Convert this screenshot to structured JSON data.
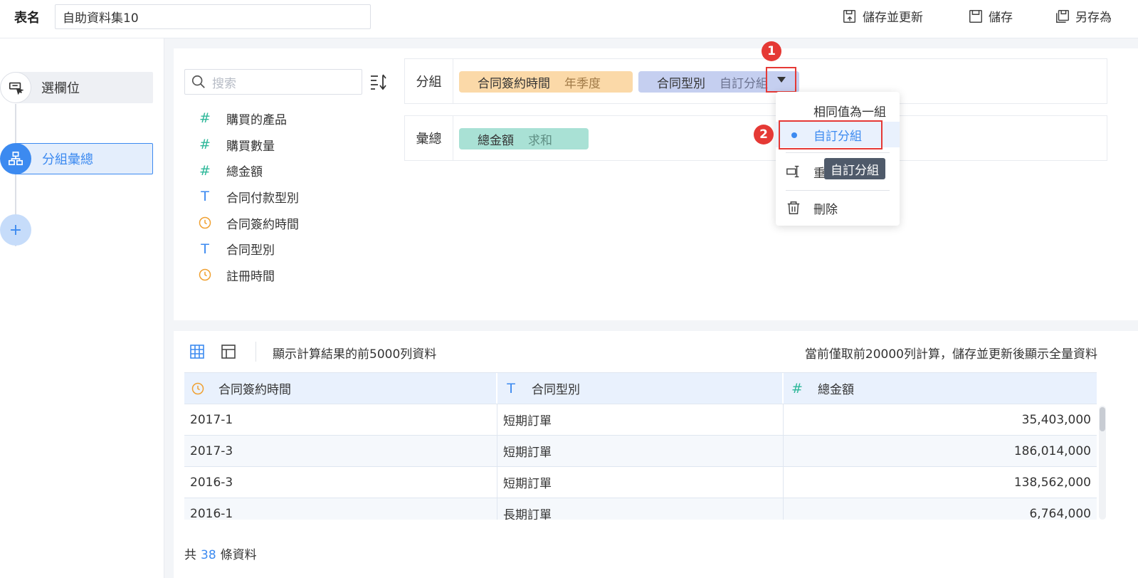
{
  "header": {
    "table_name_label": "表名",
    "table_name_value": "自助資料集10",
    "save_update_label": "儲存並更新",
    "save_label": "儲存",
    "save_as_label": "另存為"
  },
  "sidebar": {
    "steps": [
      {
        "label": "選欄位",
        "icon": "select-fields-icon"
      },
      {
        "label": "分組彙總",
        "icon": "group-hierarchy-icon"
      },
      {
        "label": "+",
        "icon": "add-icon"
      }
    ]
  },
  "fields": {
    "search_placeholder": "搜索",
    "items": [
      {
        "icon": "#",
        "type": "number",
        "label": "購買的產品"
      },
      {
        "icon": "#",
        "type": "number",
        "label": "購買數量"
      },
      {
        "icon": "#",
        "type": "number",
        "label": "總金額"
      },
      {
        "icon": "T",
        "type": "text",
        "label": "合同付款型別"
      },
      {
        "icon": "clock",
        "type": "time",
        "label": "合同簽約時間"
      },
      {
        "icon": "T",
        "type": "text",
        "label": "合同型別"
      },
      {
        "icon": "clock",
        "type": "time",
        "label": "註冊時間"
      }
    ]
  },
  "grouping": {
    "group_label": "分組",
    "group_chips": [
      {
        "name": "合同簽約時間",
        "mode": "年季度",
        "color": "#fbd9a8"
      },
      {
        "name": "合同型別",
        "mode": "自訂分組",
        "color": "#c5cff0"
      }
    ],
    "summary_label": "彙總",
    "summary_chips": [
      {
        "name": "總金額",
        "mode": "求和",
        "color": "#a9e1d5"
      }
    ]
  },
  "dropdown_menu": {
    "items": [
      {
        "label": "相同值為一組"
      },
      {
        "label": "自訂分組",
        "selected": true
      },
      {
        "label": "重命名",
        "visible_label": "重"
      },
      {
        "label": "刪除"
      }
    ],
    "tooltip": "自訂分組"
  },
  "annotations": {
    "badge_1": "1",
    "badge_2": "2",
    "highlight_color": "#e53935"
  },
  "results": {
    "preview_note": "顯示計算結果的前5000列資料",
    "calc_note": "當前僅取前20000列計算，儲存並更新後顯示全量資料",
    "columns": [
      {
        "label": "合同簽約時間",
        "type": "time"
      },
      {
        "label": "合同型別",
        "type": "text"
      },
      {
        "label": "總金額",
        "type": "number"
      }
    ],
    "rows": [
      [
        "2017-1",
        "短期訂單",
        "35,403,000"
      ],
      [
        "2017-3",
        "短期訂單",
        "186,014,000"
      ],
      [
        "2016-3",
        "短期訂單",
        "138,562,000"
      ],
      [
        "2016-1",
        "長期訂單",
        "6,764,000"
      ]
    ],
    "footer_prefix": "共",
    "footer_count": "38",
    "footer_suffix": "條資料"
  },
  "colors": {
    "accent": "#3c8af0",
    "number_icon": "#2fb89a",
    "time_icon": "#f0a030"
  }
}
